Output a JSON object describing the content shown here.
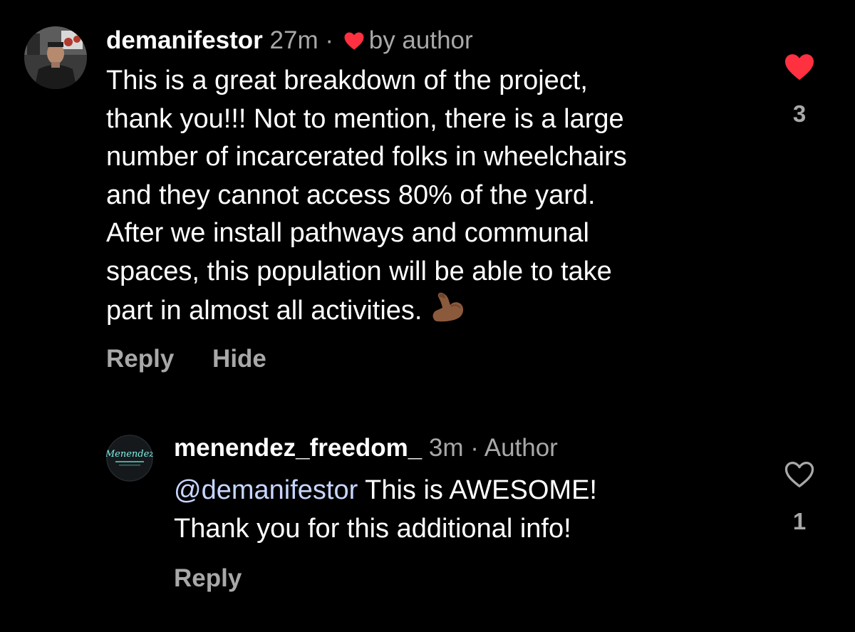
{
  "colors": {
    "background": "#000000",
    "text_primary": "#ffffff",
    "text_secondary": "#a8a8a8",
    "like_active": "#ff3040",
    "mention": "#c7d6ff"
  },
  "comments": [
    {
      "username": "demanifestor",
      "time": "27m",
      "separator": "·",
      "liked_by_author_label": "by author",
      "body_lines": [
        "This is a great breakdown of the project,",
        "thank you!!! Not to mention, there is a large",
        "number of incarcerated folks in wheelchairs",
        "and they cannot access 80% of the yard.",
        "After we install pathways and communal",
        "spaces, this population will be able to take",
        "part in almost all activities."
      ],
      "emoji": "flexed-biceps-icon",
      "actions": [
        "Reply",
        "Hide"
      ],
      "likes": "3",
      "liked": true
    },
    {
      "username": "menendez_freedom_",
      "time": "3m",
      "separator": "·",
      "author_badge": "Author",
      "mention": "@demanifestor",
      "body_line_1_rest": " This is AWESOME!",
      "body_line_2": "Thank you for this additional info!",
      "actions": [
        "Reply"
      ],
      "likes": "1",
      "liked": false
    }
  ]
}
